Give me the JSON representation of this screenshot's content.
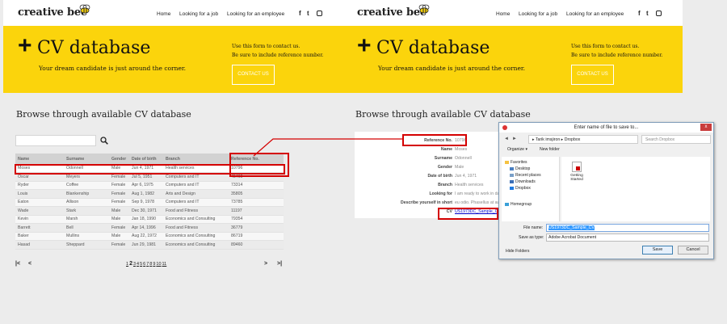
{
  "site": {
    "logo": "creative bee",
    "nav": [
      "Home",
      "Looking for a job",
      "Looking for an employee"
    ],
    "social": {
      "facebook": "f",
      "twitter": "t"
    }
  },
  "hero": {
    "plus": "+",
    "title": "CV database",
    "subtitle": "Your dream candidate is just around the corner.",
    "info_line1": "Use this form to contact us.",
    "info_line2": "Be sure to include reference number.",
    "contact_button": "CONTACT US"
  },
  "browse_title": "Browse through available CV database",
  "table": {
    "columns": [
      "Name",
      "Surname",
      "Gender",
      "Date of birth",
      "Branch",
      "Reference No."
    ],
    "rows": [
      [
        "Moses",
        "Odonnell",
        "Male",
        "Jun 4, 1971",
        "Health services",
        "10796"
      ],
      [
        "Oscar",
        "Meyers",
        "Female",
        "Jul 5, 1951",
        "Computers and IT",
        "45460"
      ],
      [
        "Ryder",
        "Coffee",
        "Female",
        "Apr 6, 1975",
        "Computers and IT",
        "73314"
      ],
      [
        "Louis",
        "Blankenship",
        "Female",
        "Aug 1, 1982",
        "Arts and Design",
        "35805"
      ],
      [
        "Eaton",
        "Allison",
        "Female",
        "Sep 9, 1978",
        "Computers and IT",
        "73785"
      ],
      [
        "Wade",
        "Stark",
        "Male",
        "Dec 30, 1971",
        "Food and Fitness",
        "11197"
      ],
      [
        "Kevin",
        "Marsh",
        "Male",
        "Jan 18, 1990",
        "Economics and Consulting",
        "79354"
      ],
      [
        "Barrett",
        "Bell",
        "Female",
        "Apr 14, 1996",
        "Food and Fitness",
        "36779"
      ],
      [
        "Baker",
        "Mullins",
        "Male",
        "Aug 22, 1972",
        "Economics and Consulting",
        "86719"
      ],
      [
        "Hasad",
        "Sheppard",
        "Female",
        "Jun 29, 1981",
        "Economics and Consulting",
        "89460"
      ]
    ]
  },
  "pager": {
    "first": "|<",
    "prev": "<",
    "next": ">",
    "last": ">|",
    "pages": [
      "1",
      "2",
      "3",
      "4",
      "5",
      "6",
      "7",
      "8",
      "9",
      "10",
      "11"
    ],
    "current": "2"
  },
  "detail": {
    "labels": [
      "Reference No.",
      "Name",
      "Surname",
      "Gender",
      "Date of birth",
      "Branch",
      "Looking for",
      "Describe yourself in short",
      "CV"
    ],
    "values": [
      "10796",
      "Moses",
      "Odonnell",
      "Male",
      "Jun 4, 1971",
      "Health services",
      "I am ready to work in dangerous",
      "eu odio. Phasellus at augue id",
      "US1973DC_Sample_CV.pdf"
    ]
  },
  "dialog": {
    "title": "Enter name of file to save to...",
    "close": "x",
    "back": "◄",
    "forward": "►",
    "address": "▸ Tarik imsjiron ▸ Dropbox",
    "search_placeholder": "Search Dropbox",
    "organize": "Organize ▾",
    "new_folder": "New folder",
    "nav_items": [
      "Favorites",
      "Desktop",
      "Recent places",
      "Downloads",
      "Dropbox",
      "Homegroup"
    ],
    "file_item": "Getting Started",
    "file_name_label": "File name:",
    "file_name_value": "US1973DC_Sample_CV",
    "save_type_label": "Save as type:",
    "save_type_value": "Adobe Acrobat Document",
    "hide_folders": "Hide Folders",
    "save": "Save",
    "cancel": "Cancel"
  },
  "colors": {
    "accent": "#fbd40c",
    "highlight": "#d40000",
    "link": "#0000cc"
  }
}
